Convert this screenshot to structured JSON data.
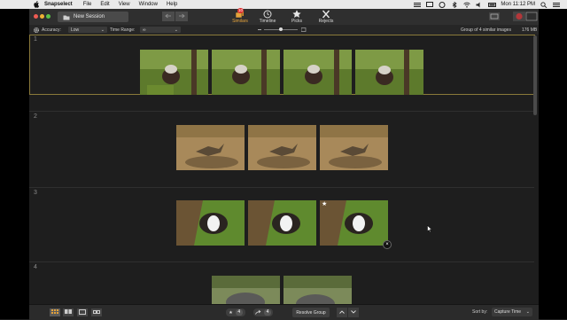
{
  "menubar": {
    "app_name": "Snapselect",
    "items": [
      "File",
      "Edit",
      "View",
      "Window",
      "Help"
    ],
    "clock": "Mon 11:12 PM"
  },
  "toolbar": {
    "new_session_label": "New Session",
    "tabs": [
      {
        "label": "Similars",
        "icon": "similars-icon",
        "badge": "10",
        "active": true
      },
      {
        "label": "Timeline",
        "icon": "clock-icon",
        "active": false
      },
      {
        "label": "Picks",
        "icon": "star-icon",
        "active": false
      },
      {
        "label": "Rejects",
        "icon": "x-icon",
        "active": false
      }
    ]
  },
  "options": {
    "accuracy_label": "Accuracy:",
    "accuracy_value": "Low",
    "time_range_label": "Time Range:",
    "time_range_value": "∞",
    "status_text": "Group of 4 similar images",
    "memory": "176 MB"
  },
  "groups": [
    {
      "number": "1",
      "subject": "red-panda",
      "count": 4
    },
    {
      "number": "2",
      "subject": "lizard",
      "count": 3
    },
    {
      "number": "3",
      "subject": "guinea-pig",
      "count": 3
    },
    {
      "number": "4",
      "subject": "boar",
      "count": 2
    }
  ],
  "bottombar": {
    "picks_count": "4",
    "rejects_count": "4",
    "resolve_label": "Resolve Group",
    "sort_label": "Sort by:",
    "sort_value": "Capture Time"
  },
  "colors": {
    "accent": "#e5a33b",
    "selected_border": "#8a7a3a",
    "badge": "#dd3333"
  }
}
